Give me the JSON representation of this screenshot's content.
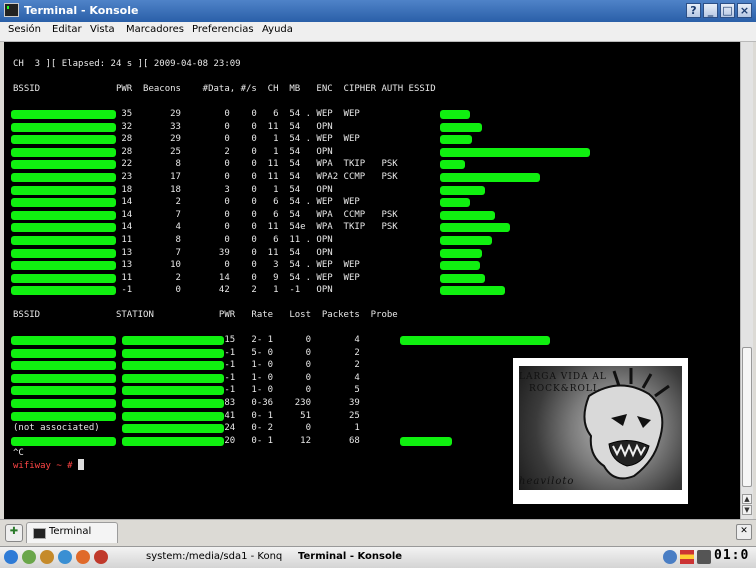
{
  "window": {
    "title": "Terminal - Konsole",
    "buttons": [
      "?",
      "_",
      "□",
      "×"
    ]
  },
  "menu": [
    "Sesión",
    "Editar",
    "Vista",
    "Marcadores",
    "Preferencias",
    "Ayuda"
  ],
  "terminal": {
    "header": "CH  3 ][ Elapsed: 24 s ][ 2009-04-08 23:09",
    "ap_header": "BSSID              PWR  Beacons    #Data, #/s  CH  MB   ENC  CIPHER AUTH ESSID",
    "ap_rows": [
      "                    35       29        0    0   6  54 . WEP  WEP",
      "                    32       33        0    0  11  54   OPN",
      "                    28       29        0    0   1  54 . WEP  WEP",
      "                    28       25        2    0   1  54   OPN",
      "                    22        8        0    0  11  54   WPA  TKIP   PSK",
      "                    23       17        0    0  11  54   WPA2 CCMP   PSK",
      "                    18       18        3    0   1  54   OPN",
      "                    14        2        0    0   6  54 . WEP  WEP",
      "                    14        7        0    0   6  54   WPA  CCMP   PSK",
      "                    14        4        0    0  11  54e  WPA  TKIP   PSK",
      "                    11        8        0    0   6  11 . OPN",
      "                    13        7       39    0  11  54   OPN",
      "                    13       10        0    0   3  54 . WEP  WEP",
      "                    11        2       14    0   9  54 . WEP  WEP",
      "                    -1        0       42    2   1  -1   OPN"
    ],
    "st_header": "BSSID              STATION            PWR   Rate   Lost  Packets  Probe",
    "st_rows": [
      "                                       15   2- 1      0        4",
      "                                       -1   5- 0      0        2",
      "                                       -1   1- 0      0        2",
      "                                       -1   1- 0      0        4",
      "                                       -1   1- 0      0        5",
      "                                       83   0-36    230       39",
      "                                       41   0- 1     51       25",
      "(not associated)                       24   0- 2      0        1",
      "                                       20   0- 1     12       68"
    ],
    "interrupt": "^C",
    "prompt": "wifiway ~ #"
  },
  "image": {
    "caption_top": "LARGA VIDA AL",
    "caption_mid": "ROCK&ROLL",
    "signature": "heaviloto"
  },
  "tabs": [
    {
      "label": "Terminal"
    }
  ],
  "taskbar": {
    "tasks": [
      "system:/media/sda1 - Konq",
      "Terminal - Konsole"
    ],
    "clock": "01:0"
  },
  "colors": {
    "terminal_bg": "#000000",
    "censor": "#10f010",
    "prompt": "#ff4545",
    "titlebar": "#3a6db5"
  }
}
